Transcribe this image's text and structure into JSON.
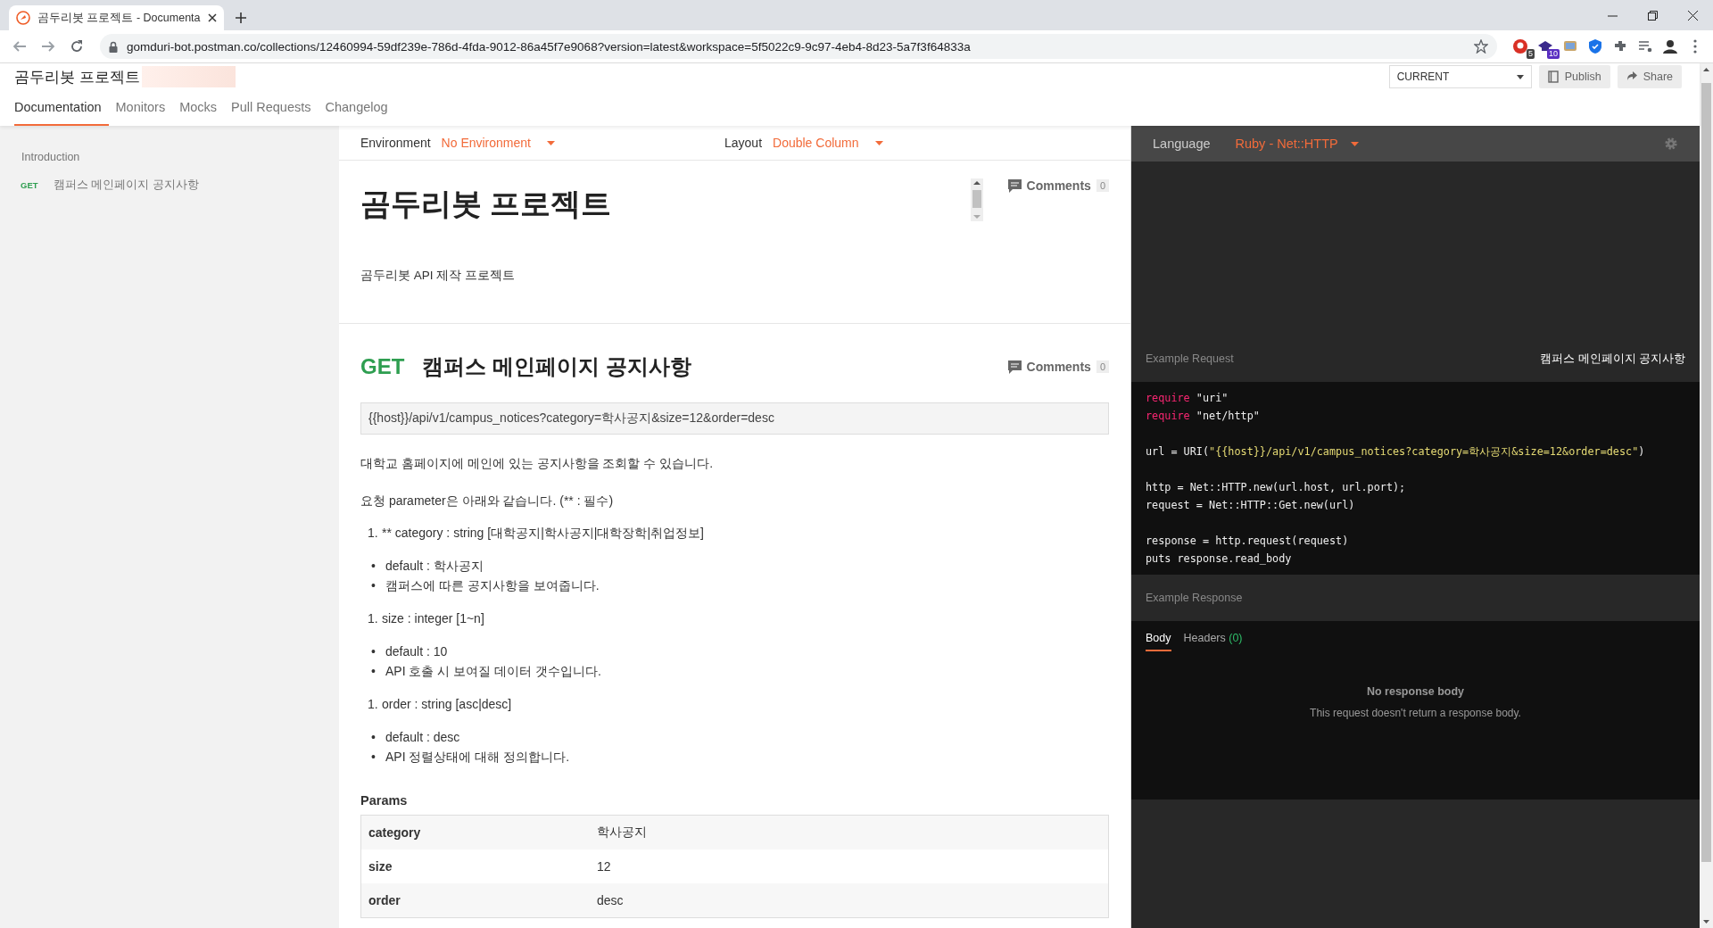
{
  "browser": {
    "tab_title": "곰두리봇 프로젝트 - Documenta",
    "url": "gomduri-bot.postman.co/collections/12460994-59df239e-786d-4fda-9012-86a45f7e9068?version=latest&workspace=5f5022c9-9c97-4eb4-8d23-5a7f3f64833a",
    "extension_badges": [
      "5",
      "10"
    ]
  },
  "header": {
    "title": "곰두리봇 프로젝트",
    "version": "CURRENT",
    "buttons": [
      "Publish",
      "Share"
    ],
    "tabs": [
      {
        "label": "Documentation",
        "selected": true
      },
      {
        "label": "Monitors",
        "selected": false
      },
      {
        "label": "Mocks",
        "selected": false
      },
      {
        "label": "Pull Requests",
        "selected": false
      },
      {
        "label": "Changelog",
        "selected": false
      }
    ]
  },
  "sidebar": {
    "items": [
      {
        "label": "Introduction"
      },
      {
        "label": "캠퍼스 메인페이지 공지사항",
        "method": "GET"
      }
    ]
  },
  "toolbar": {
    "environment_label": "Environment",
    "environment": "No Environment",
    "layout_label": "Layout",
    "layout": "Double Column"
  },
  "intro": {
    "title": "곰두리봇 프로젝트",
    "description": "곰두리봇 API 제작 프로젝트",
    "comments_label": "Comments",
    "comments_count": "0"
  },
  "request": {
    "method": "GET",
    "name": "캠퍼스 메인페이지 공지사항",
    "comments_label": "Comments",
    "comments_count": "0",
    "url": "{{host}}/api/v1/campus_notices?category=학사공지&size=12&order=desc",
    "description": [
      {
        "kind": "p",
        "items": [
          "대학교 홈페이지에 메인에 있는 공지사항을 조회할 수 있습니다."
        ]
      },
      {
        "kind": "p",
        "items": [
          "요청 parameter은 아래와 같습니다. (** : 필수)"
        ]
      },
      {
        "kind": "ol",
        "items": [
          {
            "marker": "1.",
            "text": "** category : string [대학공지|학사공지|대학장학|취업정보]"
          }
        ]
      },
      {
        "kind": "ul",
        "items": [
          {
            "marker": "•",
            "text": "default : 학사공지"
          },
          {
            "marker": "•",
            "text": "캠퍼스에 따른 공지사항을 보여줍니다."
          }
        ]
      },
      {
        "kind": "ol",
        "items": [
          {
            "marker": "1.",
            "text": "size : integer [1~n]"
          }
        ]
      },
      {
        "kind": "ul",
        "items": [
          {
            "marker": "•",
            "text": "default : 10"
          },
          {
            "marker": "•",
            "text": "API 호출 시 보여질 데이터 갯수입니다."
          }
        ]
      },
      {
        "kind": "ol",
        "items": [
          {
            "marker": "1.",
            "text": "order : string [asc|desc]"
          }
        ]
      },
      {
        "kind": "ul",
        "items": [
          {
            "marker": "•",
            "text": "default : desc"
          },
          {
            "marker": "•",
            "text": "API 정렬상태에 대해 정의합니다."
          }
        ]
      }
    ],
    "params_title": "Params",
    "params": [
      {
        "key": "category",
        "value": "학사공지"
      },
      {
        "key": "size",
        "value": "12"
      },
      {
        "key": "order",
        "value": "desc"
      }
    ]
  },
  "code_panel": {
    "language_label": "Language",
    "language": "Ruby - Net::HTTP",
    "example_request_label": "Example Request",
    "example_request_name": "캠퍼스 메인페이지 공지사항",
    "code_blocks": [
      [
        [
          {
            "kind": "keyword",
            "text": "require"
          },
          {
            "kind": "plain",
            "text": " \"uri\""
          }
        ],
        [
          {
            "kind": "keyword",
            "text": "require"
          },
          {
            "kind": "plain",
            "text": " \"net/http\""
          }
        ]
      ],
      [
        [
          {
            "kind": "plain",
            "text": "url = URI("
          },
          {
            "kind": "string",
            "text": "\"{{host}}/api/v1/campus_notices?category=학사공지&size=12&order=desc\""
          },
          {
            "kind": "plain",
            "text": ")"
          }
        ]
      ],
      [
        [
          {
            "kind": "plain",
            "text": "http = Net::HTTP.new(url.host, url.port);"
          }
        ],
        [
          {
            "kind": "plain",
            "text": "request = Net::HTTP::Get.new(url)"
          }
        ]
      ],
      [
        [
          {
            "kind": "plain",
            "text": "response = http.request(request)"
          }
        ],
        [
          {
            "kind": "plain",
            "text": "puts response.read_body"
          }
        ]
      ]
    ],
    "example_response_label": "Example Response",
    "response_tabs": [
      {
        "label": "Body",
        "selected": true
      },
      {
        "label": "Headers",
        "count": "(0)",
        "selected": false
      }
    ],
    "empty_title": "No response body",
    "empty_message": "This request doesn't return a response body."
  }
}
